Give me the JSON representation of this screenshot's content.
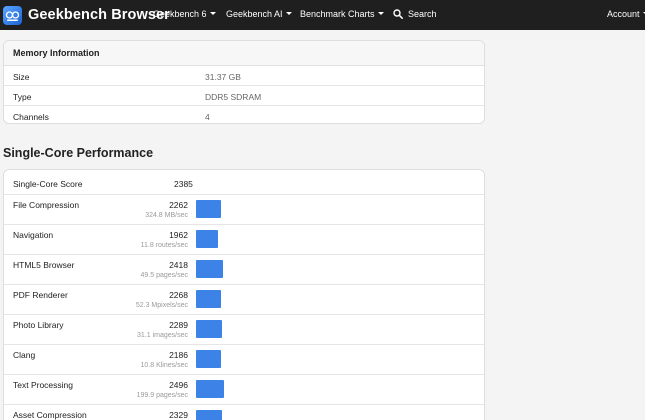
{
  "navbar": {
    "brand": "Geekbench Browser",
    "items": [
      {
        "label": "Geekbench 6"
      },
      {
        "label": "Geekbench AI"
      },
      {
        "label": "Benchmark Charts"
      }
    ],
    "search_label": "Search",
    "account_label": "Account"
  },
  "memory": {
    "title": "Memory Information",
    "rows": [
      {
        "key": "Size",
        "value": "31.37 GB"
      },
      {
        "key": "Type",
        "value": "DDR5 SDRAM"
      },
      {
        "key": "Channels",
        "value": "4"
      }
    ]
  },
  "single_core": {
    "title": "Single-Core Performance",
    "score_label": "Single-Core Score",
    "score": "2385",
    "bar_max": 2496,
    "benchmarks": [
      {
        "name": "File Compression",
        "score": "2262",
        "rate": "324.8 MB/sec",
        "value": 2262
      },
      {
        "name": "Navigation",
        "score": "1962",
        "rate": "11.8 routes/sec",
        "value": 1962
      },
      {
        "name": "HTML5 Browser",
        "score": "2418",
        "rate": "49.5 pages/sec",
        "value": 2418
      },
      {
        "name": "PDF Renderer",
        "score": "2268",
        "rate": "52.3 Mpixels/sec",
        "value": 2268
      },
      {
        "name": "Photo Library",
        "score": "2289",
        "rate": "31.1 images/sec",
        "value": 2289
      },
      {
        "name": "Clang",
        "score": "2186",
        "rate": "10.8 Klines/sec",
        "value": 2186
      },
      {
        "name": "Text Processing",
        "score": "2496",
        "rate": "199.9 pages/sec",
        "value": 2496
      },
      {
        "name": "Asset Compression",
        "score": "2329",
        "rate": "",
        "value": 2329
      }
    ]
  },
  "colors": {
    "navbar": "#1f1f1f",
    "bar": "#3d82e6",
    "background": "#f4f4f4"
  },
  "icons": [
    "geekbench-logo-icon",
    "search-icon",
    "caret-down-icon"
  ]
}
